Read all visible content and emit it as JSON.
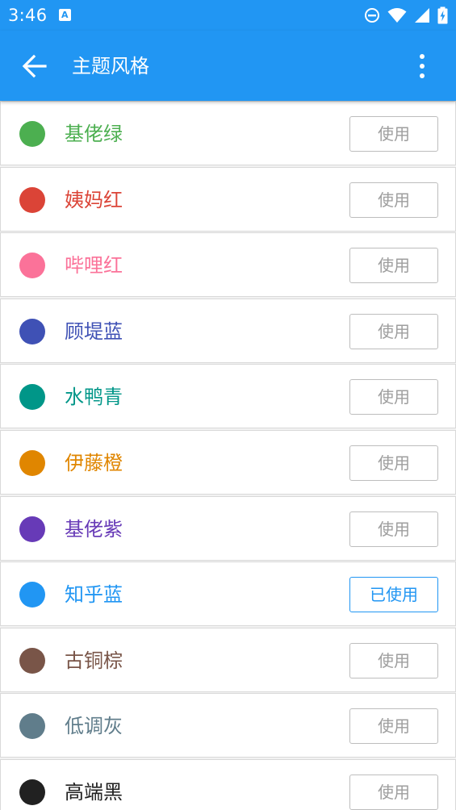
{
  "status_bar": {
    "time": "3:46",
    "icons": [
      "text-notification-icon",
      "do-not-disturb-icon",
      "wifi-icon",
      "cellular-signal-icon",
      "battery-charging-icon"
    ]
  },
  "app_bar": {
    "title": "主题风格",
    "back_icon": "arrow-back-icon",
    "menu_icon": "more-vert-icon",
    "background": "#2196f3"
  },
  "themes": [
    {
      "name": "基佬绿",
      "color": "#4caf50",
      "button": "使用",
      "active": false
    },
    {
      "name": "姨妈红",
      "color": "#db4437",
      "button": "使用",
      "active": false
    },
    {
      "name": "哔哩红",
      "color": "#fb7299",
      "button": "使用",
      "active": false
    },
    {
      "name": "顾堤蓝",
      "color": "#3f51b5",
      "button": "使用",
      "active": false
    },
    {
      "name": "水鸭青",
      "color": "#009688",
      "button": "使用",
      "active": false
    },
    {
      "name": "伊藤橙",
      "color": "#e08600",
      "button": "使用",
      "active": false
    },
    {
      "name": "基佬紫",
      "color": "#673ab7",
      "button": "使用",
      "active": false
    },
    {
      "name": "知乎蓝",
      "color": "#2196f3",
      "button": "已使用",
      "active": true
    },
    {
      "name": "古铜棕",
      "color": "#795548",
      "button": "使用",
      "active": false
    },
    {
      "name": "低调灰",
      "color": "#607d8b",
      "button": "使用",
      "active": false
    },
    {
      "name": "高端黑",
      "color": "#212121",
      "button": "使用",
      "active": false
    }
  ]
}
